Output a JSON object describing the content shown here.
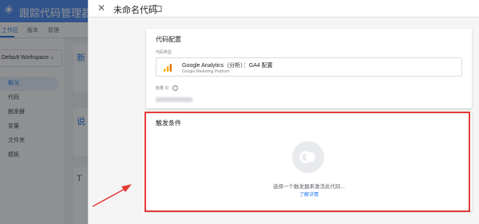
{
  "background": {
    "app_title": "跟踪代码管理器",
    "tabs": [
      "工作区",
      "版本",
      "管理"
    ],
    "workspace": "Default Workspace",
    "nav_items": [
      "概况",
      "代码",
      "触发器",
      "变量",
      "文件夹",
      "模板"
    ],
    "card_titles": [
      "新",
      "说",
      "T"
    ],
    "brand_color": "#4285f4"
  },
  "panel": {
    "tag_name": "未命名代码",
    "close_icon": "close-icon",
    "folder_icon": "folder-icon"
  },
  "config": {
    "title": "代码配置",
    "tag_type_label": "代码类型",
    "tag_type": {
      "name": "Google Analytics（分析）：GA4 配置",
      "subtitle": "Google Marketing Platform",
      "icon": "google-analytics-icon"
    },
    "measurement_label": "衡量 ID",
    "help_icon": "help-icon"
  },
  "trigger": {
    "title": "触发条件",
    "empty_message": "选择一个触发器来激活此代码...",
    "learn_more": "了解详情",
    "icon": "trigger-icon"
  },
  "annotation": {
    "highlight_color": "#e53935"
  }
}
